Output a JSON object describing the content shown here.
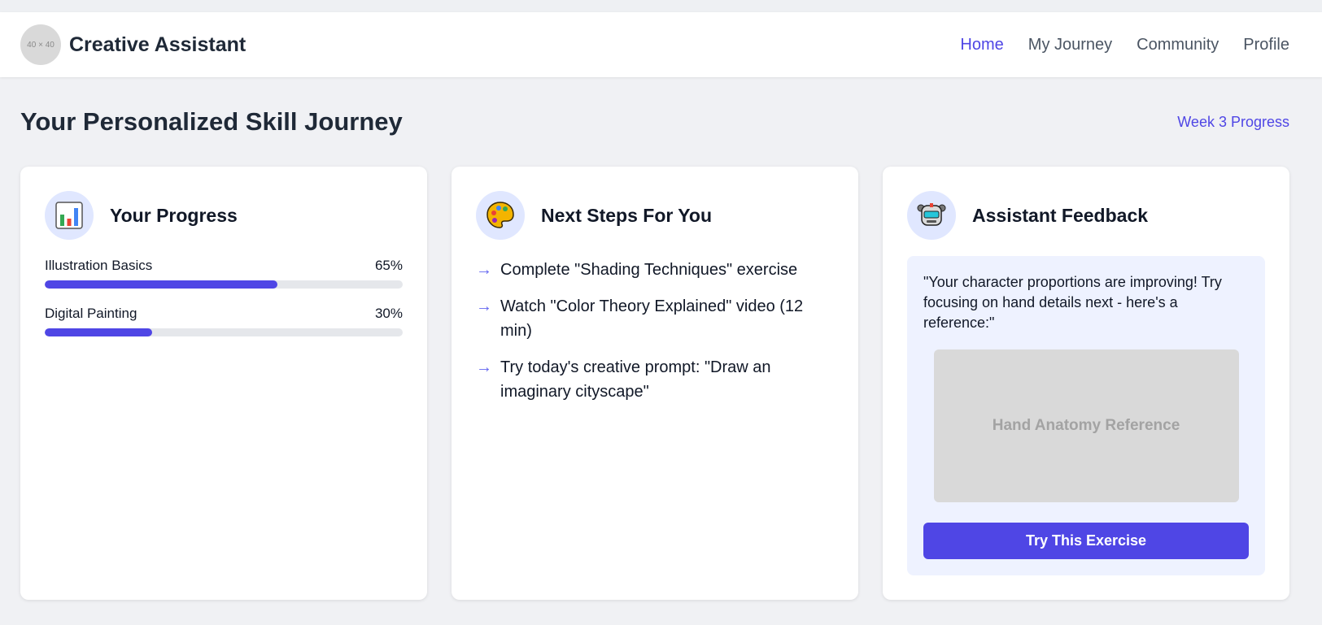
{
  "header": {
    "logo_text": "40 × 40",
    "app_name": "Creative Assistant",
    "nav": [
      {
        "label": "Home",
        "active": true
      },
      {
        "label": "My Journey",
        "active": false
      },
      {
        "label": "Community",
        "active": false
      },
      {
        "label": "Profile",
        "active": false
      }
    ]
  },
  "page": {
    "title": "Your Personalized Skill Journey",
    "week_link": "Week 3 Progress"
  },
  "progress_card": {
    "title": "Your Progress",
    "icon": "bar-chart-icon",
    "items": [
      {
        "label": "Illustration Basics",
        "percent_text": "65%",
        "value": 65
      },
      {
        "label": "Digital Painting",
        "percent_text": "30%",
        "value": 30
      }
    ]
  },
  "steps_card": {
    "title": "Next Steps For You",
    "icon": "palette-icon",
    "arrow": "→",
    "steps": [
      "Complete \"Shading Techniques\" exercise",
      "Watch \"Color Theory Explained\" video (12 min)",
      "Try today's creative prompt: \"Draw an imaginary cityscape\""
    ]
  },
  "feedback_card": {
    "title": "Assistant Feedback",
    "icon": "robot-icon",
    "message": "\"Your character proportions are improving! Try focusing on hand details next - here's a reference:\"",
    "image_label": "Hand Anatomy Reference",
    "button_label": "Try This Exercise"
  },
  "colors": {
    "accent": "#4f46e5",
    "icon_bg": "#e0e7ff",
    "feedback_bg": "#eef2ff",
    "track": "#e5e7eb"
  }
}
